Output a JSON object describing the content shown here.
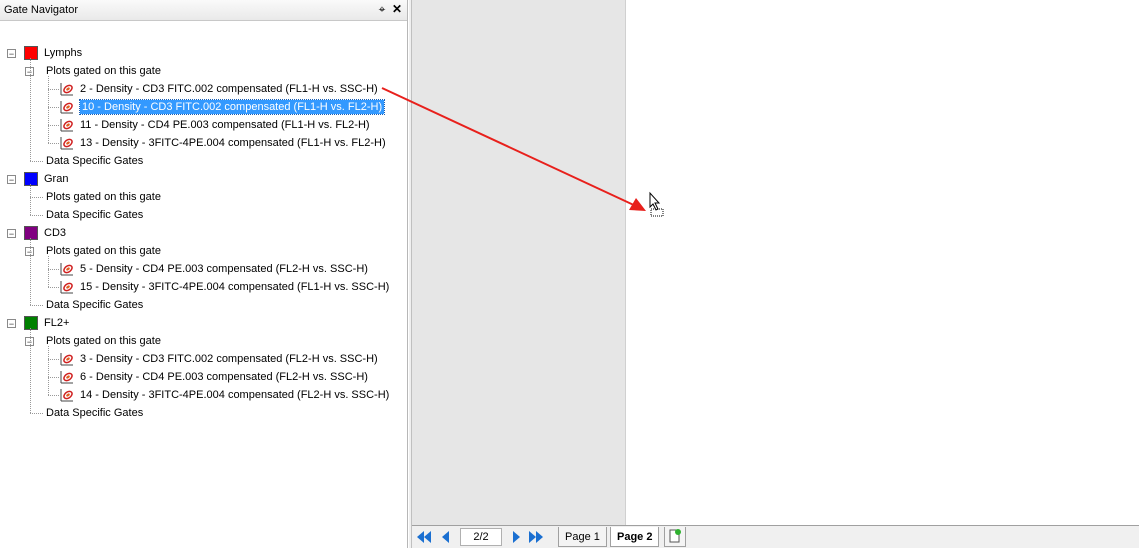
{
  "panel": {
    "title": "Gate Navigator",
    "pin_glyph": "⌖",
    "close_glyph": "✕"
  },
  "tree": {
    "gates": [
      {
        "name": "Lymphs",
        "color": "#ff0000",
        "plots_label": "Plots gated on this gate",
        "plots": [
          "2 - Density - CD3 FITC.002 compensated (FL1-H vs. SSC-H)",
          "10 - Density - CD3 FITC.002 compensated (FL1-H vs. FL2-H)",
          "11 - Density - CD4 PE.003 compensated (FL1-H vs. FL2-H)",
          "13 - Density - 3FITC-4PE.004 compensated (FL1-H vs. FL2-H)"
        ],
        "data_label": "Data Specific Gates"
      },
      {
        "name": "Gran",
        "color": "#0000ff",
        "plots_label": "Plots gated on this gate",
        "plots": [],
        "data_label": "Data Specific Gates"
      },
      {
        "name": "CD3",
        "color": "#800080",
        "plots_label": "Plots gated on this gate",
        "plots": [
          "5 - Density - CD4 PE.003 compensated (FL2-H vs. SSC-H)",
          "15 - Density - 3FITC-4PE.004 compensated (FL1-H vs. SSC-H)"
        ],
        "data_label": "Data Specific Gates"
      },
      {
        "name": "FL2+",
        "color": "#008000",
        "plots_label": "Plots gated on this gate",
        "plots": [
          "3 - Density - CD3 FITC.002 compensated (FL2-H vs. SSC-H)",
          "6 - Density - CD4 PE.003 compensated (FL2-H vs. SSC-H)",
          "14 - Density - 3FITC-4PE.004 compensated (FL2-H vs. SSC-H)"
        ],
        "data_label": "Data Specific Gates"
      }
    ],
    "selected_plot": "10 - Density - CD3 FITC.002 compensated (FL1-H vs. FL2-H)"
  },
  "navigator": {
    "page_indicator": "2/2",
    "tabs": [
      {
        "label": "Page 1",
        "active": false
      },
      {
        "label": "Page 2",
        "active": true
      }
    ]
  },
  "colors": {
    "selection": "#3399ff",
    "drag_arrow": "#e8201c",
    "nav_arrow": "#1a6fd1"
  },
  "icons": {
    "plot": "density-plot-icon",
    "first": "first-page-icon",
    "prev": "prev-page-icon",
    "next": "next-page-icon",
    "last": "last-page-icon",
    "new_page": "new-page-icon",
    "cursor": "drag-copy-cursor-icon"
  }
}
